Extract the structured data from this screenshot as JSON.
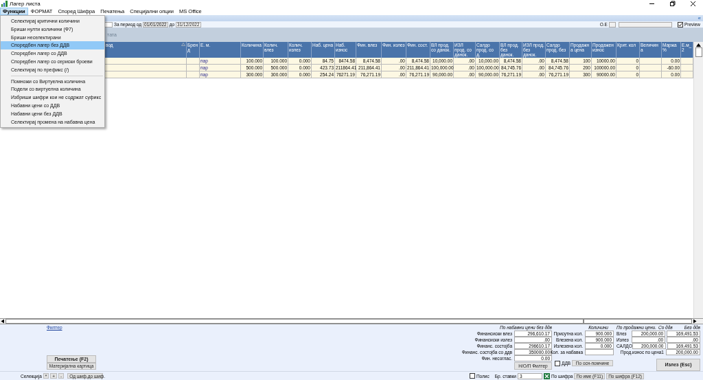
{
  "window": {
    "title": "Лагер листа"
  },
  "menu_bar": [
    {
      "label": "Функции",
      "selected": true
    },
    {
      "label": "ФОРМАТ",
      "selected": false
    },
    {
      "label": "Според Шифра",
      "selected": false
    },
    {
      "label": "Печатења",
      "selected": false
    },
    {
      "label": "Специјални опции",
      "selected": false
    },
    {
      "label": "MS Office",
      "selected": false
    }
  ],
  "dropdown": {
    "sections": [
      {
        "items": [
          {
            "label": "Селектирај критични количини",
            "selected": false
          },
          {
            "label": "Бриши нулти количини (Ф7)",
            "selected": false
          },
          {
            "label": "Бриши неселектирани",
            "selected": false
          },
          {
            "label": "Споредбен лагер без ДДВ",
            "selected": true
          },
          {
            "label": "Споредбен лагер со ДДВ",
            "selected": false
          },
          {
            "label": "Споредбен лагер со сериски броеви",
            "selected": false
          },
          {
            "label": "Селектирај по префикс (/)",
            "selected": false
          }
        ]
      },
      {
        "items": [
          {
            "label": "Помножи со Виртуелна количина",
            "selected": false
          },
          {
            "label": "Подели со виртуелна количина",
            "selected": false
          },
          {
            "label": "Избриши шифри кои не содржат суфикс",
            "selected": false
          },
          {
            "label": "Набавни цени со ДДВ",
            "selected": false
          },
          {
            "label": "Набавни цени без ДДВ",
            "selected": false
          },
          {
            "label": "Селектирај промена на набавна цена",
            "selected": false
          }
        ]
      }
    ]
  },
  "strip": {
    "collapse": "«"
  },
  "filter": {
    "period_label": "За период од",
    "date_from": "01/01/2022",
    "to_label": "до",
    "date_to": "31/12/2022",
    "oe_label": "O.E",
    "preview": {
      "label": "Preview",
      "checked": true
    }
  },
  "group_panel": {
    "hint": "тата"
  },
  "table": {
    "columns": [
      "вод",
      "Бренд",
      "Е. м.",
      "Количина",
      "Колич. влез",
      "Колич. излез",
      "Наб. цена",
      "Наб. износ",
      "Фин. влез",
      "Фин. излез",
      "Фин. сост.",
      "ВЛ прод. со данок.",
      "ИЗЛ прод. со данок.",
      "Салдо прод. со д.",
      "ВЛ прод. без данок.",
      "ИЗЛ прод. без данок.",
      "Салдо прод. без",
      "Продажна цена",
      "Продажен износ",
      "Крит. кол",
      "Величина",
      "Маржа %",
      "Е.м_2"
    ],
    "rows": [
      {
        "cells": [
          null,
          null,
          "пар",
          "100.000",
          "100.000",
          "0.000",
          "84.75",
          "8474.58",
          "8,474.58",
          ".00",
          "8,474.58",
          "10,000.00",
          ".00",
          "10,000.00",
          "8,474.58",
          ".00",
          "8,474.58",
          "100",
          "10000.00",
          "0",
          null,
          "0.00",
          null
        ]
      },
      {
        "cells": [
          null,
          null,
          "пар",
          "500.000",
          "500.000",
          "0.000",
          "423.73",
          "211864.41",
          "211,864.41",
          ".00",
          "211,864.41",
          "100,000.00",
          ".00",
          "100,000.00",
          "84,745.76",
          ".00",
          "84,745.76",
          "200",
          "100000.00",
          "0",
          null,
          "-60.00",
          null
        ]
      },
      {
        "cells": [
          null,
          null,
          "пар",
          "300.000",
          "300.000",
          "0.000",
          "254.24",
          "76271.19",
          "76,271.19",
          ".00",
          "76,271.19",
          "90,000.00",
          ".00",
          "90,000.00",
          "76,271.19",
          ".00",
          "76,271.19",
          "300",
          "90000.00",
          "0",
          null,
          "0.00",
          null
        ]
      }
    ]
  },
  "bottom": {
    "filter_link": "Филтер",
    "print_button": "Печатење (F2)",
    "card_button": "Материјална картица",
    "selection": {
      "label": "Селекција",
      "buttons": [
        "*",
        "+",
        "-",
        "Од шиф.до шиф."
      ]
    },
    "purchase": {
      "title": "По набавни цени без ддв",
      "rows": [
        {
          "label": "Финансиски влез",
          "value": "296,610.17"
        },
        {
          "label": "Финансиски излез",
          "value": ".00"
        },
        {
          "label": "Финанс. состојба",
          "value": "296610.17"
        },
        {
          "label": "Финанс. состојба со ддв",
          "value": "350000.00"
        },
        {
          "label": "Фин. несоглас.",
          "value": "0.00"
        }
      ],
      "button": "Н/О/П Филтер"
    },
    "quantities": {
      "title": "Количини",
      "rows": [
        {
          "label": "Присутна кол.",
          "value": "900.000"
        },
        {
          "label": "Влезена кол.",
          "value": "900.000"
        },
        {
          "label": "Излезена кол.",
          "value": "0.000"
        },
        {
          "label": "Кол. за набавка"
        }
      ]
    },
    "sales": {
      "title": "По продажни цени.",
      "col1": "Со ддв",
      "col2": "Без ддв",
      "rows": [
        {
          "label": "Влез",
          "values": [
            "200,000.00",
            "169,491.53"
          ]
        },
        {
          "label": "Излез",
          "values": [
            ".00",
            ".00"
          ]
        },
        {
          "label": "САЛДО",
          "values": [
            "200,000.00",
            "169,491.53"
          ]
        }
      ],
      "total": {
        "label": "Прод.износ по цена1",
        "value": "200,000.00"
      }
    },
    "vat": {
      "label": "ДДВ",
      "checked": false
    },
    "vat_button": "По осн-помчине",
    "exit_button": "Излез (Esc)"
  },
  "status_bar": {
    "polis": {
      "label": "Полис",
      "checked": false
    },
    "count_label": "Бр. ставки",
    "count": "3",
    "by_code_label": "По шифра",
    "buttons": [
      "По име (F11)",
      "По шифра (F12)"
    ]
  }
}
